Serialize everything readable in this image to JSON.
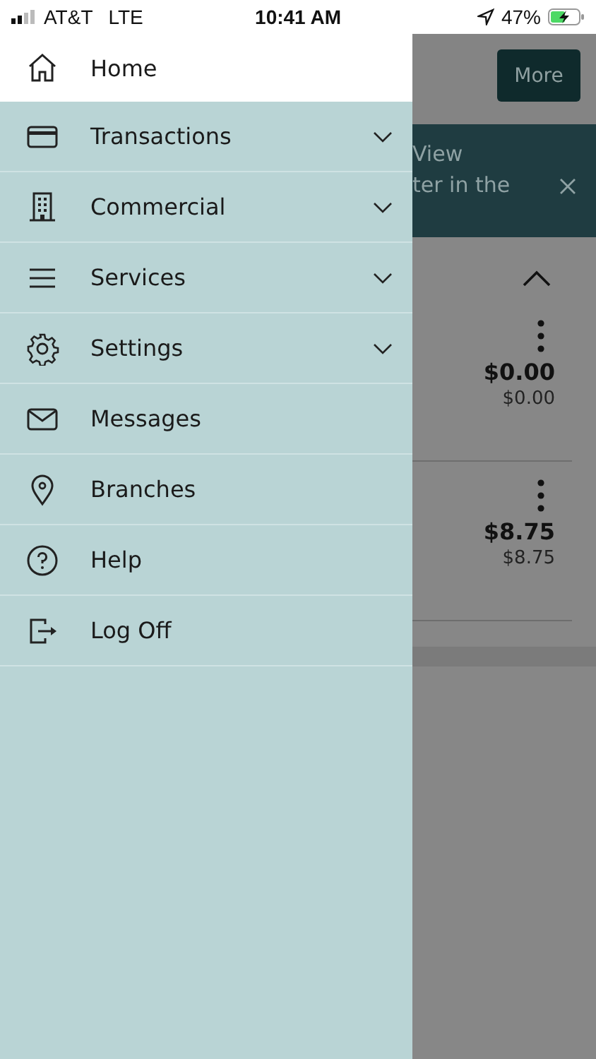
{
  "status_bar": {
    "carrier": "AT&T",
    "network": "LTE",
    "time": "10:41 AM",
    "battery": "47%"
  },
  "menu": [
    {
      "label": "Home",
      "kind": "link",
      "selected": true
    },
    {
      "label": "Transactions",
      "kind": "expandable",
      "selected": false,
      "expanded": false
    },
    {
      "label": "Commercial",
      "kind": "expandable",
      "selected": false,
      "expanded": false
    },
    {
      "label": "Services",
      "kind": "expandable",
      "selected": false,
      "expanded": false
    },
    {
      "label": "Settings",
      "kind": "expandable",
      "selected": false,
      "expanded": false
    },
    {
      "label": "Messages",
      "kind": "link",
      "selected": false
    },
    {
      "label": "Branches",
      "kind": "link",
      "selected": false
    },
    {
      "label": "Help",
      "kind": "link",
      "selected": false
    },
    {
      "label": "Log Off",
      "kind": "link",
      "selected": false
    }
  ],
  "background": {
    "more_button": "More",
    "banner_lines": [
      "View",
      "ter in the"
    ],
    "section_expanded": true,
    "accounts": [
      {
        "balance": "$0.00",
        "available": "$0.00"
      },
      {
        "balance": "$8.75",
        "available": "$8.75"
      }
    ]
  }
}
